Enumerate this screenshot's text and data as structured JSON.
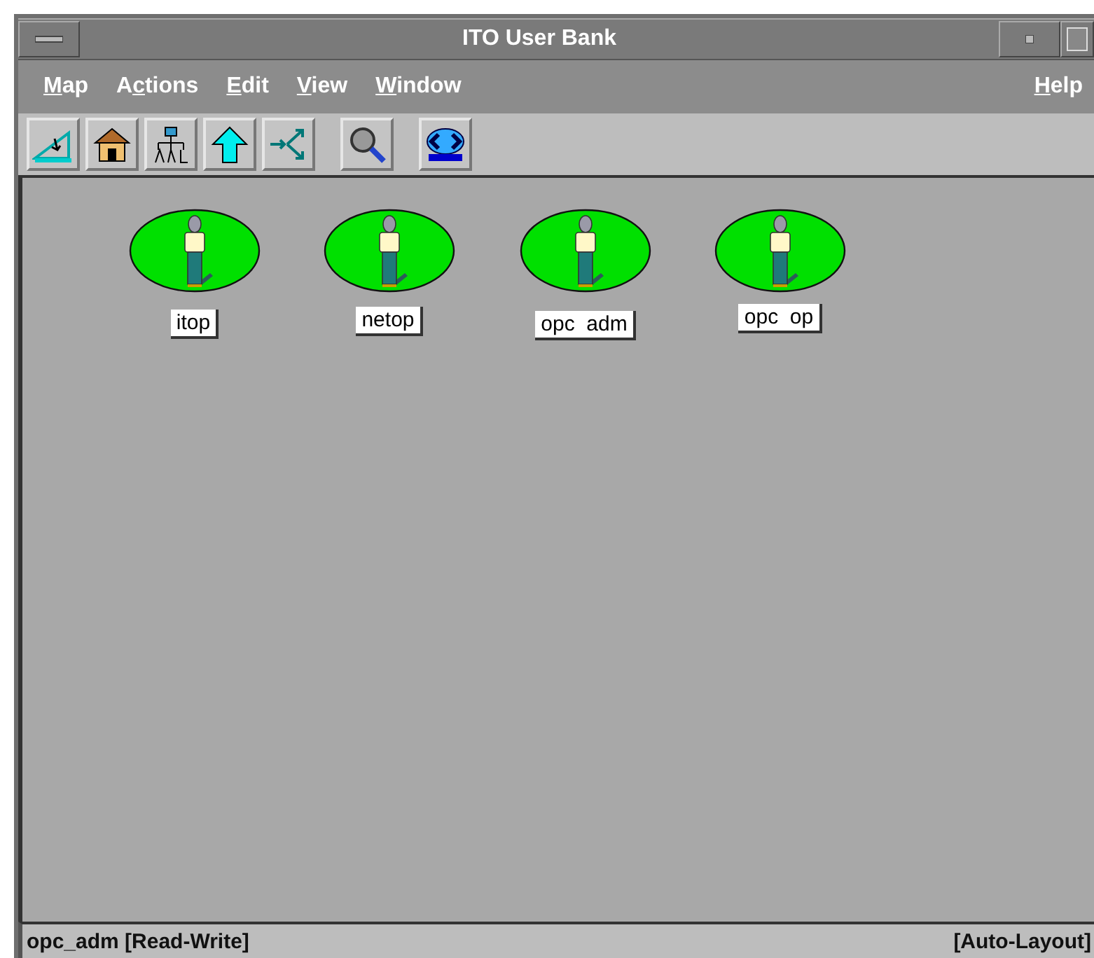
{
  "window": {
    "title": "ITO User Bank"
  },
  "menu": [
    {
      "mnemonic": "M",
      "rest": "ap"
    },
    {
      "lead": "A",
      "mnemonic": "c",
      "rest": "tions"
    },
    {
      "mnemonic": "E",
      "rest": "dit"
    },
    {
      "mnemonic": "V",
      "rest": "iew"
    },
    {
      "mnemonic": "W",
      "rest": "indow"
    },
    {
      "mnemonic": "H",
      "rest": "elp"
    }
  ],
  "users": [
    {
      "label": "itop"
    },
    {
      "label": "netop"
    },
    {
      "label": "opc  adm"
    },
    {
      "label": "opc  op"
    }
  ],
  "status_bar": {
    "left": "opc_adm [Read-Write]",
    "right": "[Auto-Layout]"
  }
}
